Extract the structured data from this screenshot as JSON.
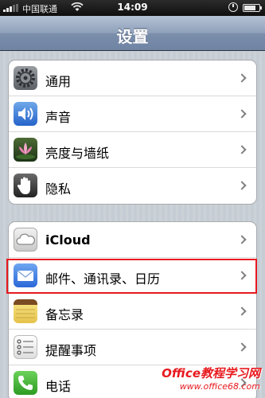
{
  "status_bar": {
    "carrier": "中国联通",
    "time": "14:09",
    "signal_bars": 3,
    "battery_fraction": 0.8
  },
  "nav_bar": {
    "title": "设置"
  },
  "groups": [
    {
      "items": [
        {
          "label": "通用",
          "icon": "gear-icon"
        },
        {
          "label": "声音",
          "icon": "speaker-icon"
        },
        {
          "label": "亮度与墙纸",
          "icon": "lotus-flower-icon"
        },
        {
          "label": "隐私",
          "icon": "hand-icon"
        }
      ]
    },
    {
      "items": [
        {
          "label": "iCloud",
          "icon": "cloud-icon"
        },
        {
          "label": "邮件、通讯录、日历",
          "icon": "mail-envelope-icon"
        },
        {
          "label": "备忘录",
          "icon": "notepad-icon"
        },
        {
          "label": "提醒事项",
          "icon": "checklist-icon"
        },
        {
          "label": "电话",
          "icon": "phone-icon"
        }
      ]
    }
  ],
  "watermark": {
    "line1": "Office教程学习网",
    "line2": "www.office68.com"
  },
  "colors": {
    "highlight_border": "#e8191e",
    "nav_bar_top": "#b5c2d4",
    "nav_bar_bottom": "#6f84a3",
    "background": "#c5ccd4"
  }
}
